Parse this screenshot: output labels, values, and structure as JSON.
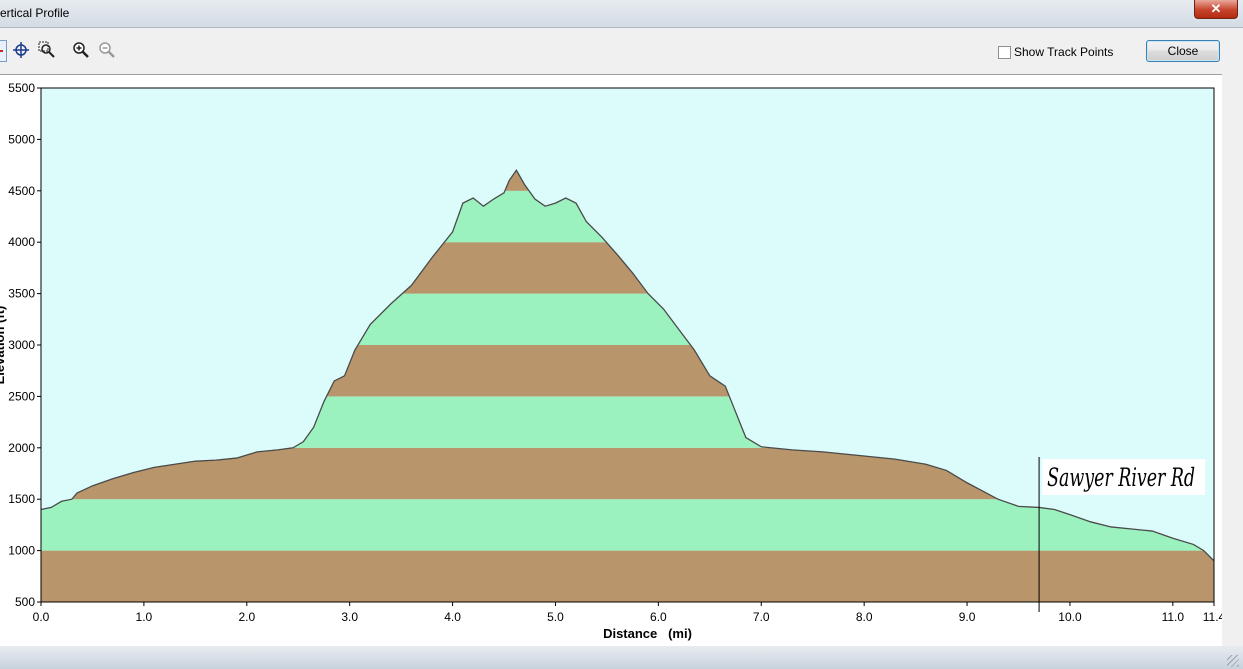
{
  "window": {
    "title": "ertical Profile",
    "close_glyph": "✕"
  },
  "toolbar": {
    "tools": [
      {
        "name": "pointer-icon"
      },
      {
        "name": "crosshair-icon"
      },
      {
        "name": "zoom-box-icon"
      },
      {
        "name": "zoom-in-icon"
      },
      {
        "name": "zoom-out-icon"
      }
    ],
    "show_track_points_label": "Show Track Points",
    "show_track_points_checked": false,
    "close_label": "Close"
  },
  "chart_data": {
    "type": "area",
    "xlabel": "Distance   (mi)",
    "ylabel": "Elevation (ft)",
    "xlim": [
      0,
      11.4
    ],
    "ylim": [
      500,
      5500
    ],
    "x_ticks": [
      "0.0",
      "1.0",
      "2.0",
      "3.0",
      "4.0",
      "5.0",
      "6.0",
      "7.0",
      "8.0",
      "9.0",
      "10.0",
      "11.0",
      "11.4"
    ],
    "x_tick_values": [
      0,
      1,
      2,
      3,
      4,
      5,
      6,
      7,
      8,
      9,
      10,
      11,
      11.4
    ],
    "y_ticks": [
      "500",
      "1000",
      "1500",
      "2000",
      "2500",
      "3000",
      "3500",
      "4000",
      "4500",
      "5000",
      "5500"
    ],
    "y_tick_values": [
      500,
      1000,
      1500,
      2000,
      2500,
      3000,
      3500,
      4000,
      4500,
      5000,
      5500
    ],
    "band_step": 500,
    "colors": {
      "background": "#dcfcfc",
      "band_brown": "#b8956a",
      "band_green": "#9cf2bf",
      "profile_line": "#4a4a4a"
    },
    "profile": [
      [
        0.0,
        1400
      ],
      [
        0.1,
        1420
      ],
      [
        0.2,
        1480
      ],
      [
        0.3,
        1500
      ],
      [
        0.35,
        1560
      ],
      [
        0.5,
        1630
      ],
      [
        0.7,
        1700
      ],
      [
        0.9,
        1760
      ],
      [
        1.1,
        1810
      ],
      [
        1.3,
        1840
      ],
      [
        1.5,
        1870
      ],
      [
        1.7,
        1880
      ],
      [
        1.9,
        1900
      ],
      [
        2.1,
        1960
      ],
      [
        2.3,
        1980
      ],
      [
        2.45,
        2000
      ],
      [
        2.55,
        2060
      ],
      [
        2.65,
        2200
      ],
      [
        2.75,
        2450
      ],
      [
        2.85,
        2650
      ],
      [
        2.95,
        2700
      ],
      [
        3.05,
        2950
      ],
      [
        3.2,
        3200
      ],
      [
        3.4,
        3400
      ],
      [
        3.6,
        3580
      ],
      [
        3.8,
        3850
      ],
      [
        4.0,
        4100
      ],
      [
        4.1,
        4380
      ],
      [
        4.2,
        4430
      ],
      [
        4.3,
        4350
      ],
      [
        4.4,
        4420
      ],
      [
        4.5,
        4480
      ],
      [
        4.55,
        4600
      ],
      [
        4.62,
        4700
      ],
      [
        4.7,
        4560
      ],
      [
        4.8,
        4420
      ],
      [
        4.9,
        4350
      ],
      [
        5.0,
        4380
      ],
      [
        5.1,
        4430
      ],
      [
        5.2,
        4380
      ],
      [
        5.3,
        4200
      ],
      [
        5.45,
        4050
      ],
      [
        5.6,
        3880
      ],
      [
        5.75,
        3700
      ],
      [
        5.9,
        3500
      ],
      [
        6.05,
        3350
      ],
      [
        6.2,
        3150
      ],
      [
        6.35,
        2950
      ],
      [
        6.5,
        2700
      ],
      [
        6.65,
        2600
      ],
      [
        6.75,
        2350
      ],
      [
        6.85,
        2100
      ],
      [
        7.0,
        2010
      ],
      [
        7.3,
        1980
      ],
      [
        7.6,
        1960
      ],
      [
        8.0,
        1920
      ],
      [
        8.3,
        1890
      ],
      [
        8.6,
        1840
      ],
      [
        8.8,
        1780
      ],
      [
        9.0,
        1660
      ],
      [
        9.15,
        1580
      ],
      [
        9.3,
        1500
      ],
      [
        9.5,
        1430
      ],
      [
        9.7,
        1420
      ],
      [
        9.85,
        1400
      ],
      [
        10.0,
        1350
      ],
      [
        10.2,
        1280
      ],
      [
        10.4,
        1230
      ],
      [
        10.6,
        1210
      ],
      [
        10.8,
        1190
      ],
      [
        11.0,
        1120
      ],
      [
        11.2,
        1060
      ],
      [
        11.3,
        1000
      ],
      [
        11.4,
        900
      ]
    ],
    "annotation": {
      "text": "Sawyer River Rd",
      "x": 9.7
    }
  }
}
